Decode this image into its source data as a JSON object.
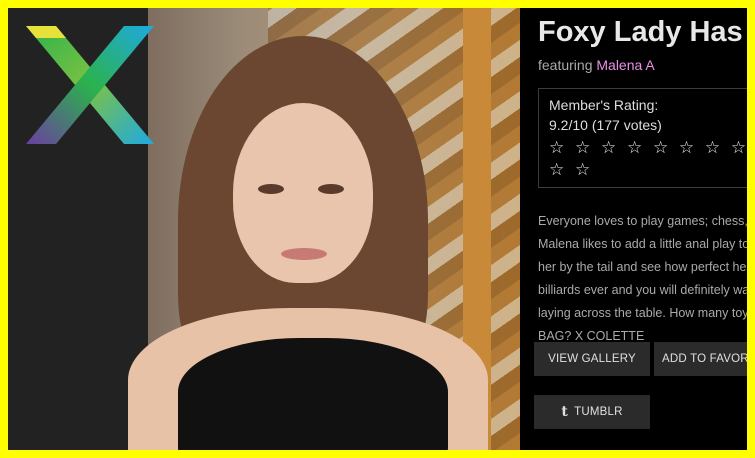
{
  "scene": {
    "title": "Foxy Lady Has",
    "featuring_prefix": "featuring ",
    "model_name": "Malena A",
    "rating_label": "Member's Rating:",
    "rating_value": "9.2/10 (177 votes)",
    "stars": [
      "☆",
      "☆",
      "☆",
      "☆",
      "☆",
      "☆",
      "☆",
      "☆",
      "☆",
      "☆"
    ],
    "description_lines": [
      "Everyone loves to play games; chess, c",
      "Malena likes to add a little anal play to h",
      "her by the tail and see how perfect her p",
      "billiards ever and you will definitely want",
      "laying across the table. How many toys",
      "BAG? X COLETTE"
    ],
    "buttons": {
      "view_gallery": "VIEW GALLERY",
      "add_favorite": "ADD TO FAVORITE",
      "tumblr_icon": "t",
      "tumblr": "TUMBLR"
    }
  },
  "colors": {
    "frame": "#ffff00",
    "background": "#000000",
    "model_link": "#ea8fe8",
    "button_bg": "#2b2b2b"
  },
  "icons": {
    "logo": "x-logo-icon",
    "tumblr": "tumblr-icon",
    "star": "star-outline-icon"
  }
}
